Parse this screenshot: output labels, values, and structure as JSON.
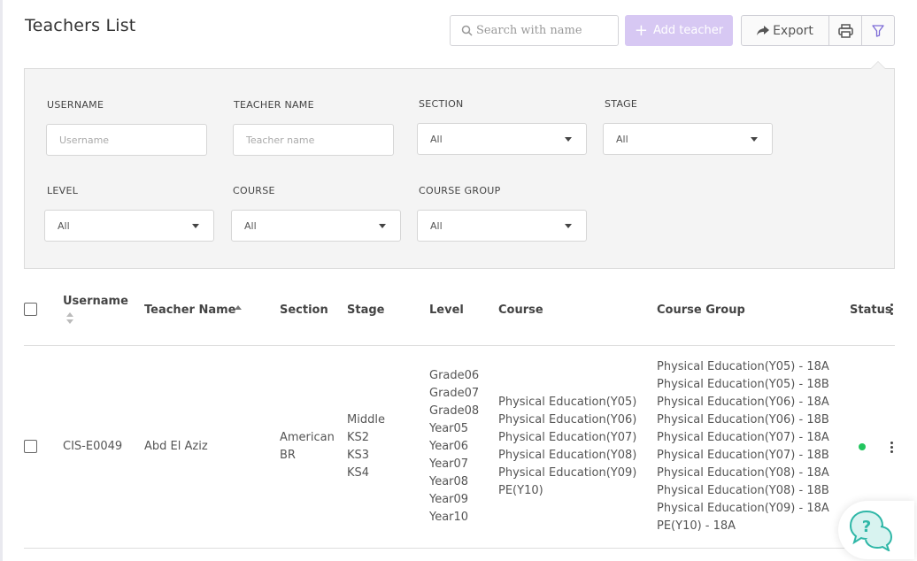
{
  "page": {
    "title": "Teachers List"
  },
  "toolbar": {
    "search_placeholder": "Search with name",
    "add_label": "Add teacher",
    "export_label": "Export",
    "accent": "#d7c8f3"
  },
  "filters": {
    "username": {
      "label": "USERNAME",
      "placeholder": "Username"
    },
    "teacher_name": {
      "label": "TEACHER NAME",
      "placeholder": "Teacher name"
    },
    "section": {
      "label": "SECTION",
      "value": "All"
    },
    "stage": {
      "label": "STAGE",
      "value": "All"
    },
    "level": {
      "label": "LEVEL",
      "value": "All"
    },
    "course": {
      "label": "COURSE",
      "value": "All"
    },
    "course_group": {
      "label": "COURSE GROUP",
      "value": "All"
    }
  },
  "table": {
    "headers": {
      "username": "Username",
      "teacher_name": "Teacher Name",
      "section": "Section",
      "stage": "Stage",
      "level": "Level",
      "course": "Course",
      "course_group": "Course Group",
      "status": "Status"
    },
    "rows": [
      {
        "username": "CIS-E0049",
        "teacher_name": "Abd El Aziz",
        "section": [
          "American",
          "BR"
        ],
        "stage": [
          "Middle",
          "KS2",
          "KS3",
          "KS4"
        ],
        "level": [
          "Grade06",
          "Grade07",
          "Grade08",
          "Year05",
          "Year06",
          "Year07",
          "Year08",
          "Year09",
          "Year10"
        ],
        "course": [
          "Physical Education(Y05)",
          "Physical Education(Y06)",
          "Physical Education(Y07)",
          "Physical Education(Y08)",
          "Physical Education(Y09)",
          "PE(Y10)"
        ],
        "course_group": [
          "Physical Education(Y05) - 18A",
          "Physical Education(Y05) - 18B",
          "Physical Education(Y06) - 18A",
          "Physical Education(Y06) - 18B",
          "Physical Education(Y07) - 18A",
          "Physical Education(Y07) - 18B",
          "Physical Education(Y08) - 18A",
          "Physical Education(Y08) - 18B",
          "Physical Education(Y09) - 18A",
          "PE(Y10) - 18A"
        ],
        "status_color": "#22c55e"
      }
    ]
  },
  "help": {
    "icon": "help-chat-icon"
  }
}
